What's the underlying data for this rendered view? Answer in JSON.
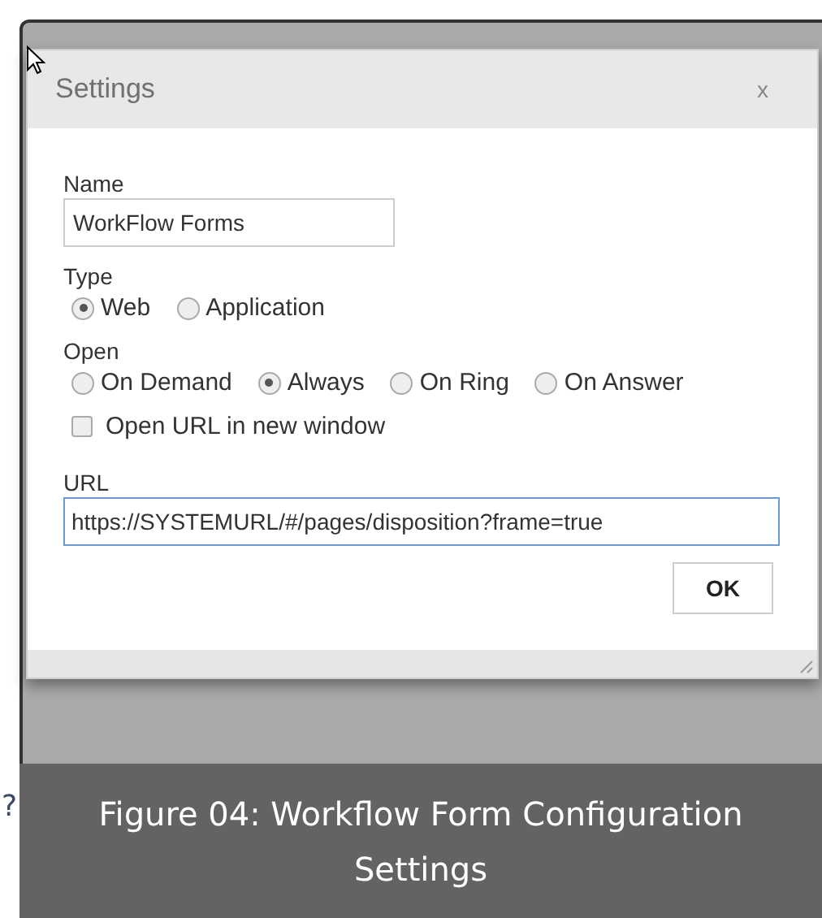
{
  "margin_text": "?",
  "dialog": {
    "title": "Settings",
    "close": "x",
    "name": {
      "label": "Name",
      "value": "WorkFlow Forms"
    },
    "type": {
      "label": "Type",
      "options": [
        {
          "label": "Web",
          "selected": true
        },
        {
          "label": "Application",
          "selected": false
        }
      ]
    },
    "open": {
      "label": "Open",
      "options": [
        {
          "label": "On Demand",
          "selected": false
        },
        {
          "label": "Always",
          "selected": true
        },
        {
          "label": "On Ring",
          "selected": false
        },
        {
          "label": "On Answer",
          "selected": false
        }
      ]
    },
    "new_window": {
      "label": "Open URL in new window",
      "checked": false
    },
    "url": {
      "label": "URL",
      "value": "https://SYSTEMURL/#/pages/disposition?frame=true"
    },
    "ok": "OK"
  },
  "caption": "Figure 04: Workflow Form Configuration Settings"
}
